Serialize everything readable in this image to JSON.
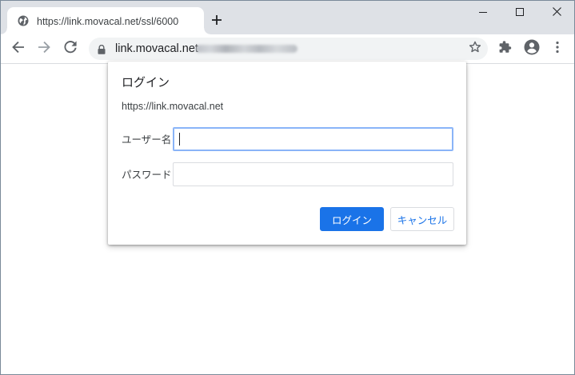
{
  "browser": {
    "tab": {
      "title": "https://link.movacal.net/ssl/6000",
      "favicon": "globe-icon"
    },
    "new_tab_icon": "plus-icon",
    "window_controls": [
      "minimize-icon",
      "maximize-icon",
      "close-icon"
    ],
    "toolbar": {
      "back_icon": "arrow-back-icon",
      "forward_icon": "arrow-forward-icon",
      "reload_icon": "reload-icon",
      "url_visible": "link.movacal.net",
      "url_obscured": true,
      "bookmark_icon": "star-icon",
      "extensions_icon": "puzzle-icon",
      "profile_icon": "account-icon",
      "menu_icon": "more-vert-icon"
    }
  },
  "dialog": {
    "title": "ログイン",
    "origin": "https://link.movacal.net",
    "username_label": "ユーザー名",
    "username_value": "",
    "password_label": "パスワード",
    "password_value": "",
    "ok_button": "ログイン",
    "cancel_button": "キャンセル"
  },
  "colors": {
    "accent": "#1a73e8",
    "tabstrip": "#dee1e6",
    "omnibox": "#f1f3f4",
    "focus_ring": "#8ab4f8"
  }
}
